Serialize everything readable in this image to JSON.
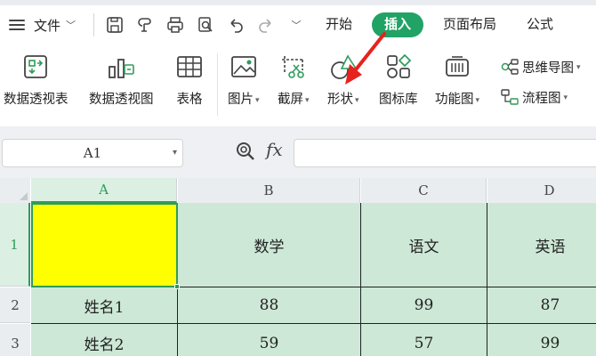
{
  "menu": {
    "file_label": "文件",
    "tabs": [
      {
        "label": "开始",
        "active": false
      },
      {
        "label": "插入",
        "active": true
      },
      {
        "label": "页面布局",
        "active": false
      },
      {
        "label": "公式",
        "active": false
      }
    ],
    "quick_access_icons": [
      "save-icon",
      "format-painter-icon",
      "print-icon",
      "print-preview-icon",
      "undo-icon",
      "redo-icon",
      "chevron-down-icon"
    ]
  },
  "ribbon": {
    "pivot_table": "数据透视表",
    "pivot_chart": "数据透视图",
    "table": "表格",
    "picture": "图片",
    "screenshot": "截屏",
    "shape": "形状",
    "icon_library": "图标库",
    "function_chart": "功能图",
    "mind_map": "思维导图",
    "flowchart": "流程图"
  },
  "formula_bar": {
    "name_box": "A1",
    "fx_label": "fx",
    "formula_value": ""
  },
  "sheet": {
    "columns": [
      "A",
      "B",
      "C",
      "D"
    ],
    "rows": [
      "1",
      "2",
      "3"
    ],
    "cells": [
      [
        "",
        "数学",
        "语文",
        "英语"
      ],
      [
        "姓名1",
        "88",
        "99",
        "87"
      ],
      [
        "姓名2",
        "59",
        "57",
        "99"
      ]
    ],
    "selected_cell": "A1"
  },
  "colors": {
    "accent": "#21a366",
    "selection": "#2e9c5a",
    "cell_fill": "#cde8d6",
    "a1_fill": "#ffff00",
    "annotation_arrow": "#e8211d"
  }
}
